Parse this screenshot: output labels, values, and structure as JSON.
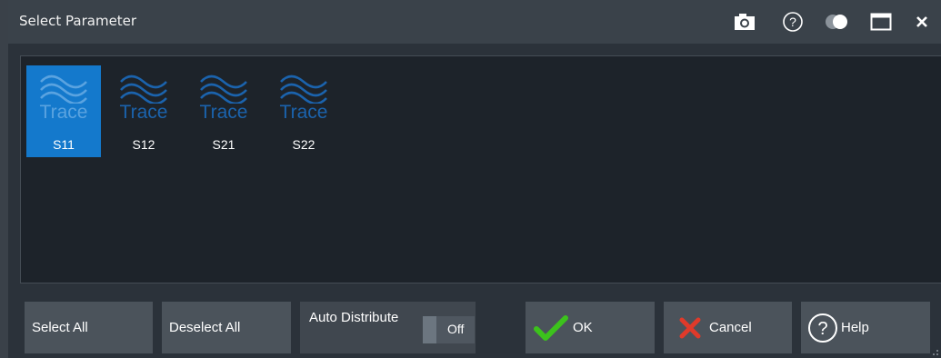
{
  "dialog": {
    "title": "Select Parameter"
  },
  "titlebar_icons": [
    "camera-icon",
    "help-icon",
    "transparency-toggle-icon",
    "maximize-icon",
    "close-icon"
  ],
  "traces": [
    {
      "word": "Trace",
      "name": "S11",
      "selected": true
    },
    {
      "word": "Trace",
      "name": "S12",
      "selected": false
    },
    {
      "word": "Trace",
      "name": "S21",
      "selected": false
    },
    {
      "word": "Trace",
      "name": "S22",
      "selected": false
    }
  ],
  "buttons": {
    "select_all": "Select All",
    "deselect_all": "Deselect All",
    "ok": "OK",
    "cancel": "Cancel",
    "help": "Help"
  },
  "auto_distribute": {
    "label": "Auto Distribute",
    "state": "Off"
  },
  "colors": {
    "selected_tile": "#1479cc",
    "trace_icon": "#1b63ad",
    "ok_check": "#3cc21c",
    "cancel_x": "#e03a2a"
  }
}
